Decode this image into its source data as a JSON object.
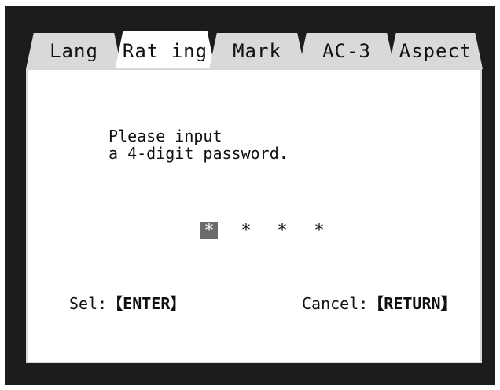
{
  "tabs": [
    {
      "label": "Lang"
    },
    {
      "label": "Rat ing"
    },
    {
      "label": "Mark"
    },
    {
      "label": "AC-3"
    },
    {
      "label": "Aspect"
    }
  ],
  "active_tab": "Rating",
  "prompt": {
    "line1": "Please input",
    "line2": "a 4-digit password."
  },
  "password": {
    "digits": [
      "*",
      "*",
      "*",
      "*"
    ],
    "selected_index": 0
  },
  "hints": {
    "select_label": "Sel:",
    "select_key": "【ENTER】",
    "cancel_label": "Cancel:",
    "cancel_key": "【RETURN】"
  },
  "colors": {
    "frame": "#1c1c1c",
    "tab_inactive": "#d9d9d9",
    "panel": "#ffffff",
    "selected_digit": "#6b6b6b"
  }
}
